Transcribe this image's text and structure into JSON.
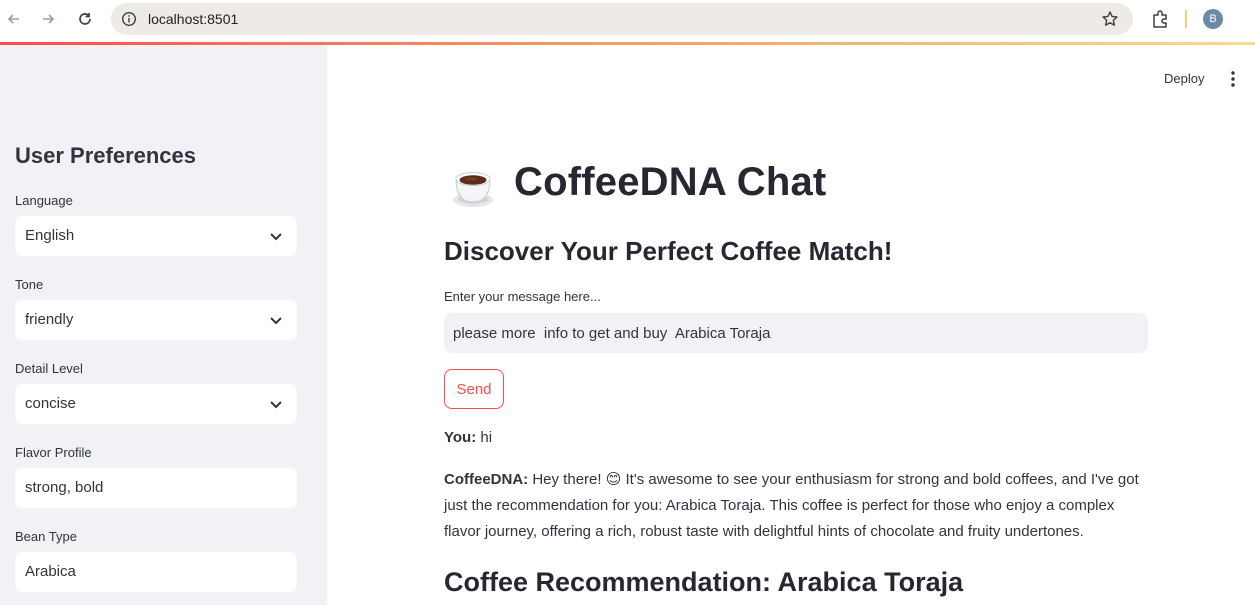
{
  "browser": {
    "url": "localhost:8501",
    "avatar_letter": "B"
  },
  "app": {
    "deploy_label": "Deploy"
  },
  "sidebar": {
    "title": "User Preferences",
    "fields": [
      {
        "label": "Language",
        "value": "English",
        "type": "select"
      },
      {
        "label": "Tone",
        "value": "friendly",
        "type": "select"
      },
      {
        "label": "Detail Level",
        "value": "concise",
        "type": "select"
      },
      {
        "label": "Flavor Profile",
        "value": "strong, bold",
        "type": "input"
      },
      {
        "label": "Bean Type",
        "value": "Arabica",
        "type": "input"
      }
    ]
  },
  "main": {
    "title_emoji": "☕",
    "title": "CoffeeDNA Chat",
    "subtitle": "Discover Your Perfect Coffee Match!",
    "input_label": "Enter your message here...",
    "input_value": "please more  info to get and buy  Arabica Toraja",
    "send_label": "Send",
    "chat": [
      {
        "speaker": "You:",
        "text": "hi"
      },
      {
        "speaker": "CoffeeDNA:",
        "text": "Hey there! 😊 It's awesome to see your enthusiasm for strong and bold coffees, and I've got just the recommendation for you: Arabica Toraja. This coffee is perfect for those who enjoy a complex flavor journey, offering a rich, robust taste with delightful hints of chocolate and fruity undertones."
      }
    ],
    "recommendation_heading": "Coffee Recommendation: Arabica Toraja"
  },
  "colors": {
    "accent": "#ff4b4b",
    "sidebar_bg": "#f0f2f6",
    "text": "#31333f"
  }
}
